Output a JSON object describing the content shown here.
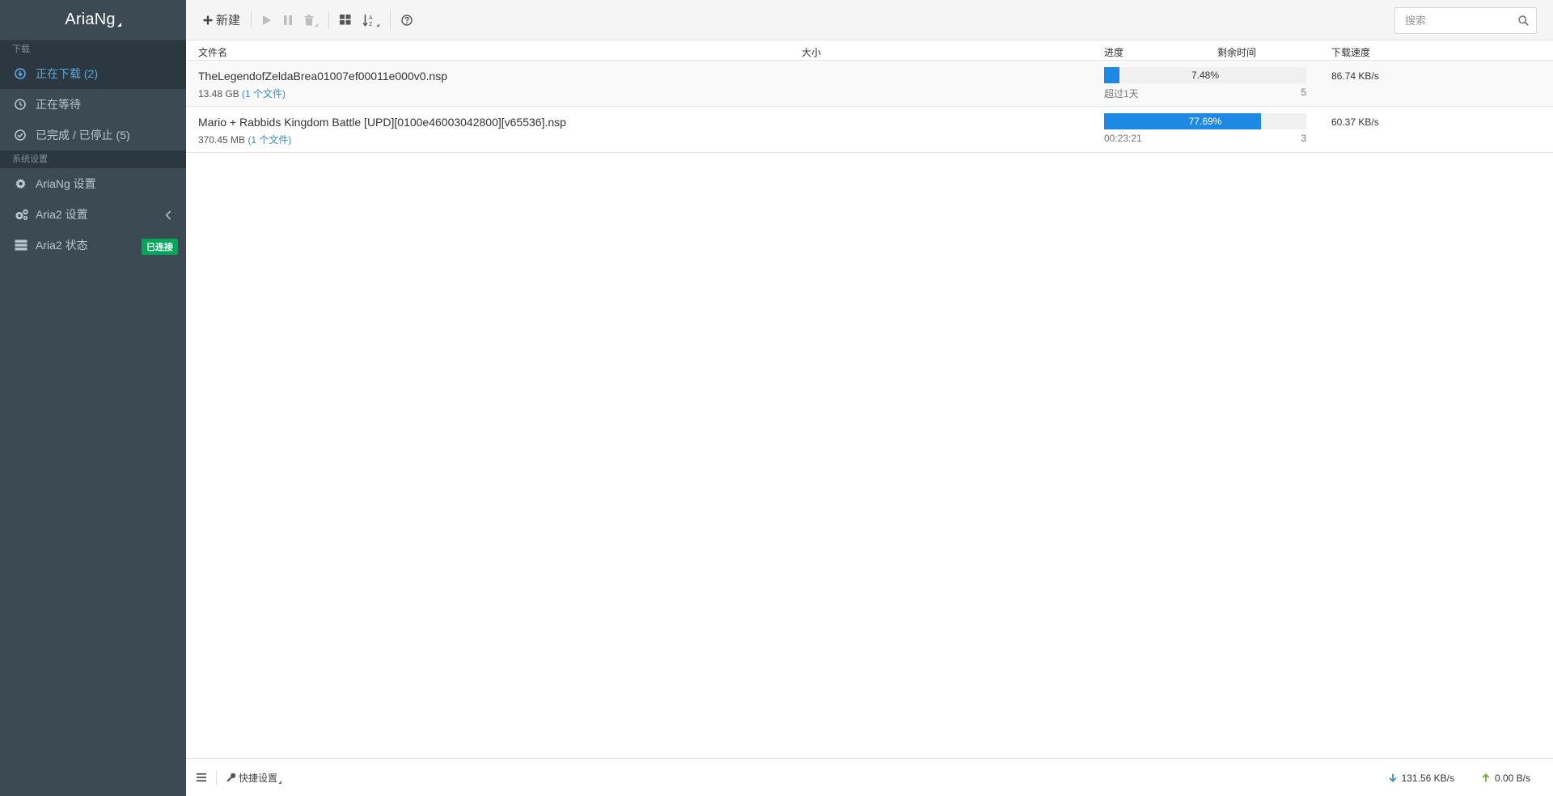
{
  "app": {
    "title": "AriaNg"
  },
  "sidebar": {
    "sections": [
      {
        "label": "下载"
      },
      {
        "label": "系统设置"
      }
    ],
    "download_items": [
      {
        "label": "正在下载 (2)",
        "icon": "download-circle-icon",
        "active": true
      },
      {
        "label": "正在等待",
        "icon": "clock-icon",
        "active": false
      },
      {
        "label": "已完成 / 已停止 (5)",
        "icon": "check-circle-icon",
        "active": false
      }
    ],
    "settings_items": [
      {
        "label": "AriaNg 设置",
        "icon": "gear-icon"
      },
      {
        "label": "Aria2 设置",
        "icon": "gears-icon"
      },
      {
        "label": "Aria2 状态",
        "icon": "server-icon",
        "badge": "已连接"
      }
    ]
  },
  "toolbar": {
    "new_label": "新建",
    "search_placeholder": "搜索"
  },
  "table": {
    "columns": {
      "name": "文件名",
      "size": "大小",
      "progress": "进度",
      "remaining": "剩余时间",
      "speed": "下载速度"
    },
    "rows": [
      {
        "name": "TheLegendofZeldaBrea01007ef00011e000v0.nsp",
        "size": "13.48 GB",
        "files": "(1 个文件)",
        "progress": 7.48,
        "progress_label": "7.48%",
        "remaining": "超过1天",
        "connections": "5",
        "speed": "86.74 KB/s"
      },
      {
        "name": "Mario + Rabbids Kingdom Battle [UPD][0100e46003042800][v65536].nsp",
        "size": "370.45 MB",
        "files": "(1 个文件)",
        "progress": 77.69,
        "progress_label": "77.69%",
        "remaining": "00:23:21",
        "connections": "3",
        "speed": "60.37 KB/s"
      }
    ]
  },
  "footer": {
    "quick_settings_label": "快捷设置",
    "download_speed": "131.56 KB/s",
    "upload_speed": "0.00 B/s"
  },
  "colors": {
    "sidebar_bg": "#3c4a53",
    "accent": "#1e88e5",
    "connected_badge": "#00a65a"
  }
}
